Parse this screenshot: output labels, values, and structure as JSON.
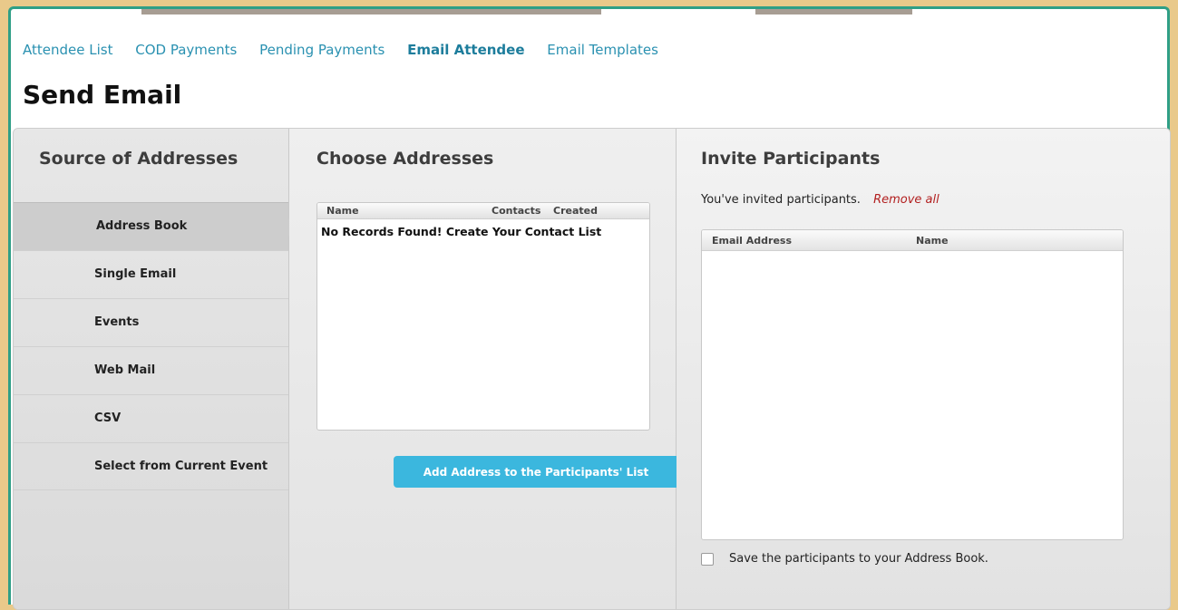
{
  "nav": {
    "tabs": [
      "Attendee List",
      "COD Payments",
      "Pending Payments",
      "Email Attendee",
      "Email Templates"
    ],
    "active": "Email Attendee"
  },
  "page_title": "Send Email",
  "source": {
    "heading": "Source of Addresses",
    "items": [
      "Address Book",
      "Single Email",
      "Events",
      "Web Mail",
      "CSV",
      "Select from Current Event"
    ],
    "selected": "Address Book"
  },
  "choose": {
    "heading": "Choose Addresses",
    "columns": [
      "Name",
      "Contacts",
      "Created"
    ],
    "empty_message": "No Records Found! Create Your Contact List",
    "add_button": "Add Address to the Participants' List"
  },
  "invite": {
    "heading": "Invite Participants",
    "status": "You've invited participants.",
    "remove_all": "Remove all",
    "columns": [
      "Email Address",
      "Name"
    ],
    "save_label": "Save the participants to your Address Book."
  },
  "colors": {
    "link": "#2a91b1",
    "button": "#3bb7de",
    "remove_link": "#b21f1f",
    "frame_border": "#2f9f86"
  }
}
